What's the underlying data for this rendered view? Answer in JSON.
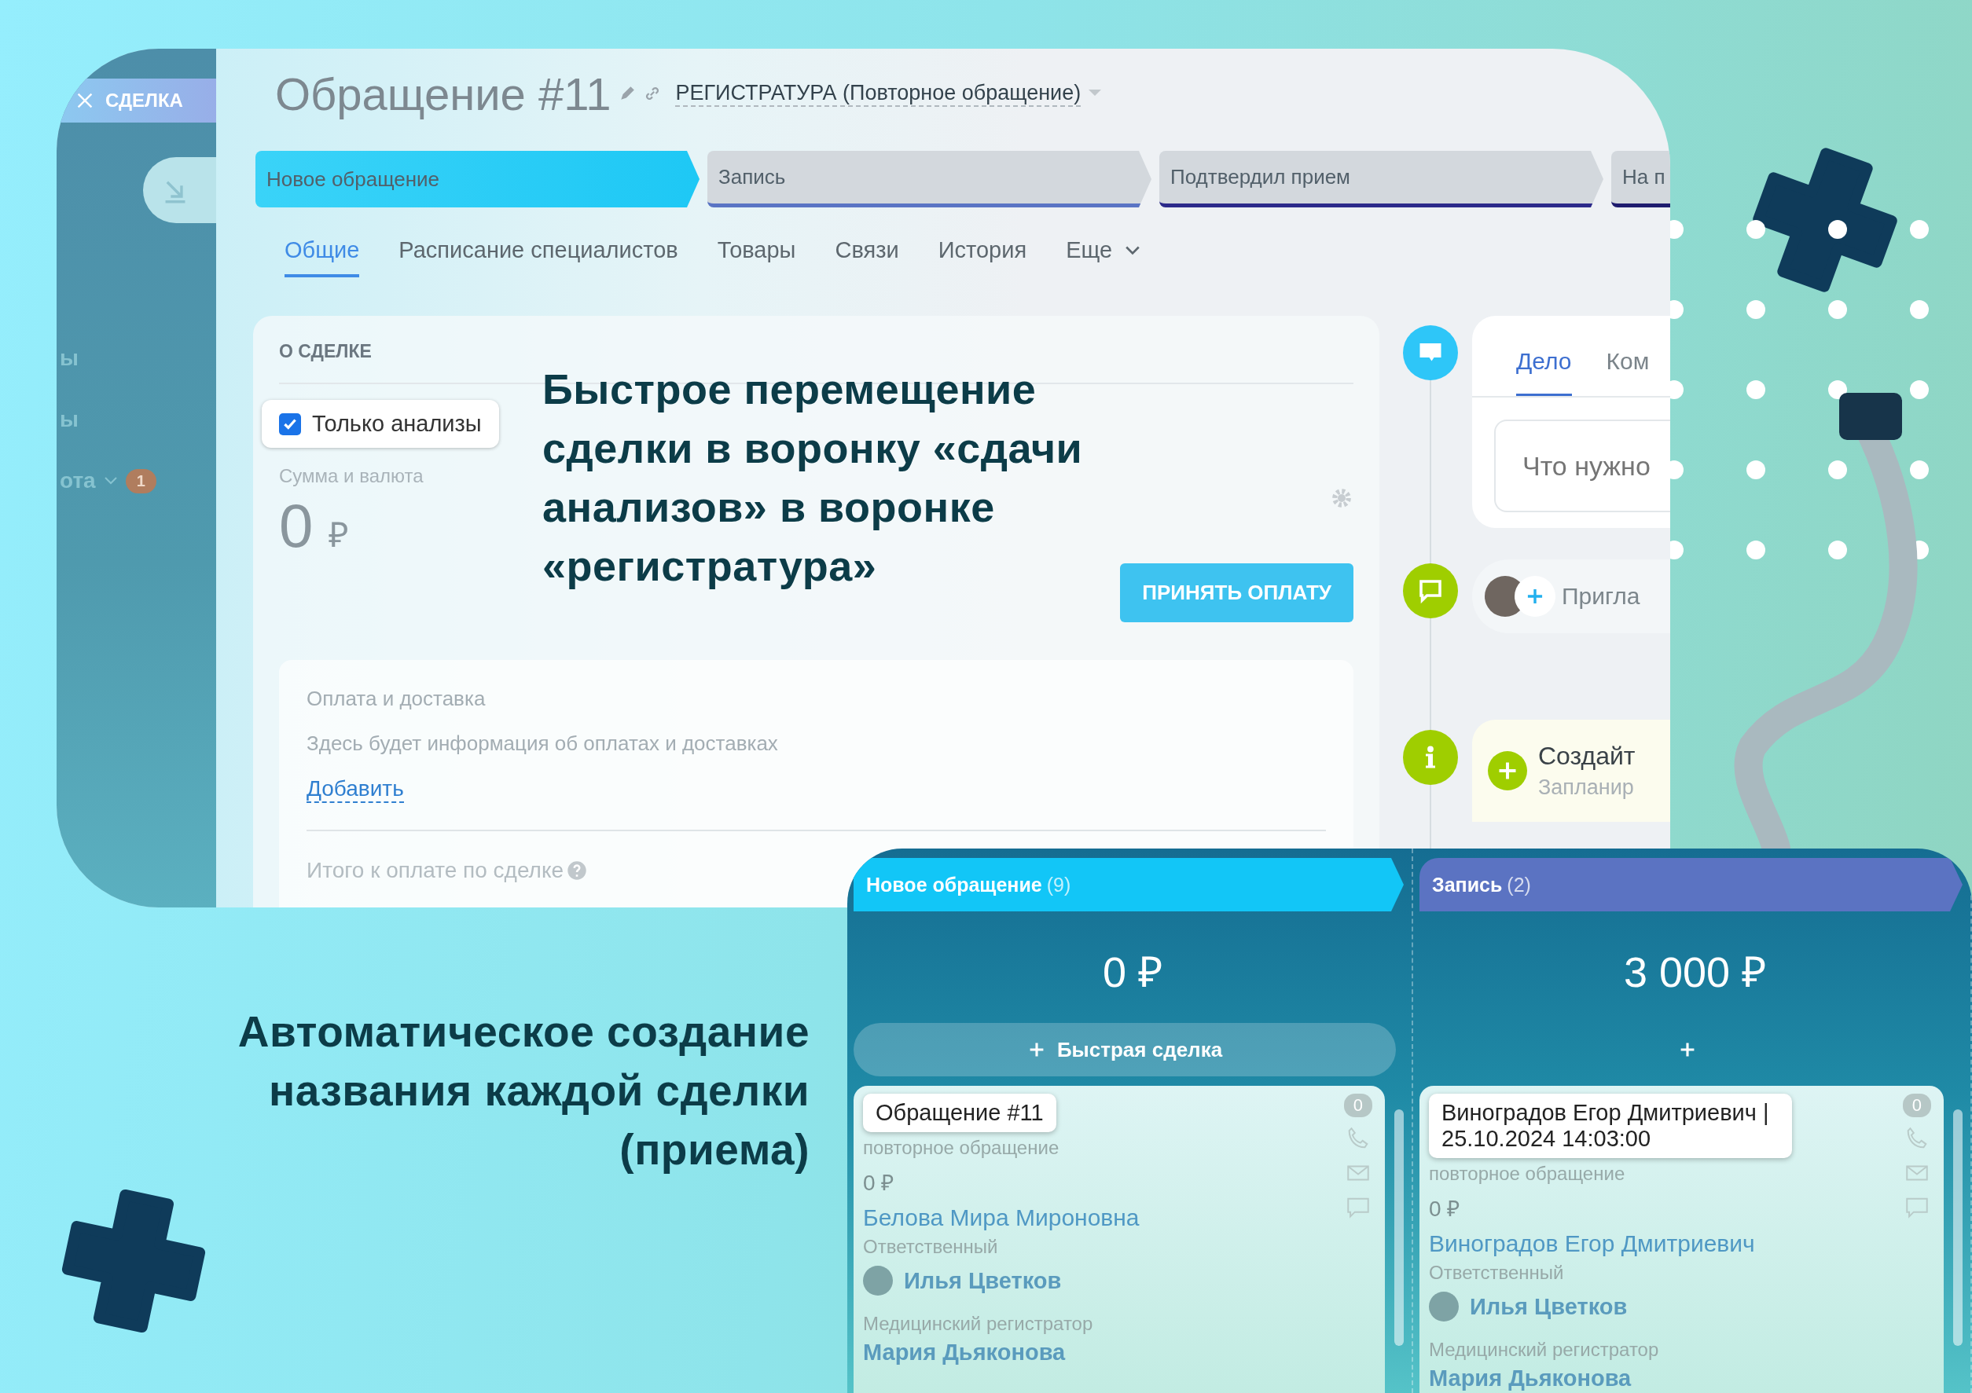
{
  "deal_window": {
    "sidebar": {
      "close_label": "СДЕЛКА",
      "items": [
        {
          "label": "ы"
        },
        {
          "label": "ы"
        },
        {
          "label": "ота",
          "badge": "1"
        }
      ]
    },
    "title": "Обращение #11",
    "category": "РЕГИСТРАТУРА (Повторное обращение)",
    "stages": [
      {
        "label": "Новое обращение",
        "selected": true,
        "color": "#1ec8f5"
      },
      {
        "label": "Запись",
        "selected": false,
        "color": "#5a74c4"
      },
      {
        "label": "Подтвердил прием",
        "selected": false,
        "color": "#2c2a8a"
      },
      {
        "label": "На п",
        "selected": false,
        "color": "#1f1c6e"
      }
    ],
    "tabs": [
      {
        "label": "Общие",
        "selected": true
      },
      {
        "label": "Расписание специалистов",
        "selected": false
      },
      {
        "label": "Товары",
        "selected": false
      },
      {
        "label": "Связи",
        "selected": false
      },
      {
        "label": "История",
        "selected": false
      },
      {
        "label": "Еще",
        "selected": false
      }
    ],
    "about": {
      "heading": "О СДЕЛКЕ",
      "checkbox": {
        "label": "Только анализы",
        "checked": true
      },
      "amount_label": "Сумма и валюта",
      "amount": "0",
      "currency": "₽",
      "pay_button": "ПРИНЯТЬ ОПЛАТУ",
      "payment": {
        "heading": "Оплата и доставка",
        "text": "Здесь будет информация об оплатах и доставках",
        "link": "Добавить"
      },
      "total_label": "Итого к оплате по сделке"
    },
    "timeline": {
      "tabs": [
        {
          "label": "Дело",
          "selected": true
        },
        {
          "label": "Ком",
          "selected": false
        }
      ],
      "placeholder": "Что нужно",
      "invite": "Пригла",
      "create_title": "Создайт",
      "create_subtitle": "Запланир"
    }
  },
  "headline": "Быстрое перемещение сделки в воронку «сдачи анализов» в воронке «регистратура»",
  "caption": "Автоматическое создание названия каждой сделки (приема)",
  "kanban": {
    "columns": [
      {
        "name": "Новое обращение",
        "count": "(9)",
        "color": "#12c6f7",
        "sum": "0 ₽",
        "quick_add": "Быстрая сделка",
        "card": {
          "title": "Обращение #11",
          "subtitle": "повторное обращение",
          "amount": "0 ₽",
          "contact": "Белова Мира Мироновна",
          "responsible_label": "Ответственный",
          "responsible": "Илья Цветков",
          "registrar_label": "Медицинский регистратор",
          "registrar": "Мария Дьяконова",
          "counter": "0"
        }
      },
      {
        "name": "Запись",
        "count": "(2)",
        "color": "#5b73c2",
        "sum": "3 000 ₽",
        "card": {
          "title": "Виноградов Егор Дмитриевич | 25.10.2024 14:03:00",
          "subtitle": "повторное обращение",
          "amount": "0 ₽",
          "contact": "Виноградов Егор Дмитриевич",
          "responsible_label": "Ответственный",
          "responsible": "Илья Цветков",
          "registrar_label": "Медицинский регистратор",
          "registrar": "Мария Дьяконова",
          "counter": "0"
        }
      }
    ]
  }
}
